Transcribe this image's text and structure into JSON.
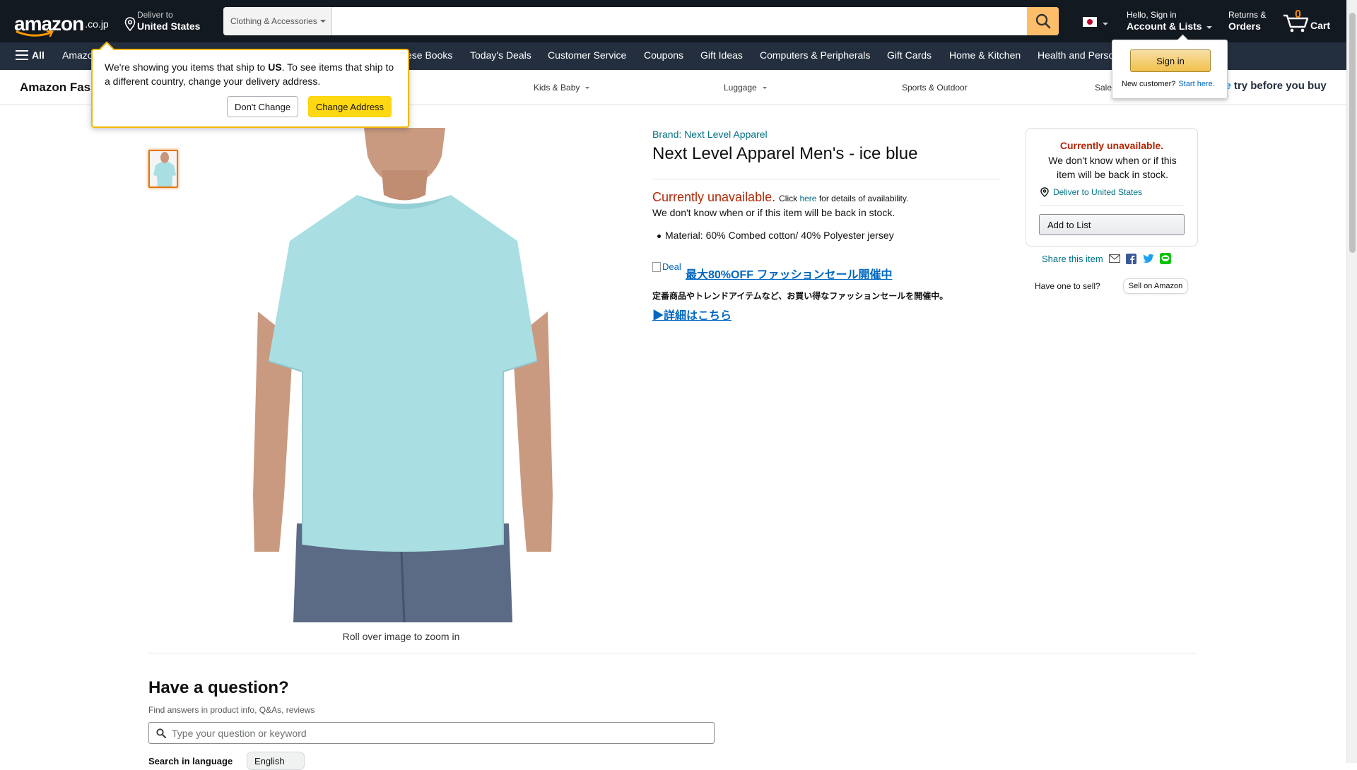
{
  "header": {
    "logo_text": "amazon",
    "logo_tld": ".co.jp",
    "deliver_line1": "Deliver to",
    "deliver_line2": "United States",
    "search_category": "Clothing & Accessories",
    "search_placeholder": "",
    "language_flag": "JP",
    "account_line1": "Hello, Sign in",
    "account_line2": "Account & Lists",
    "orders_line1": "Returns &",
    "orders_line2": "Orders",
    "cart_count": "0",
    "cart_label": "Cart"
  },
  "subnav": {
    "all_label": "All",
    "items": [
      "Amazon",
      "ese Books",
      "Today's Deals",
      "Customer Service",
      "Coupons",
      "Gift Ideas",
      "Computers & Peripherals",
      "Gift Cards",
      "Home & Kitchen",
      "Health and Perso"
    ]
  },
  "category_bar": {
    "title": "Amazon Fas",
    "links": [
      "Kids & Baby",
      "Luggage",
      "Sports & Outdoor",
      "Sale"
    ],
    "promo_prefix": "me",
    "promo_text": "try before you buy"
  },
  "address_popover": {
    "message_pre": "We're showing you items that ship to ",
    "message_country": "US",
    "message_post": ". To see items that ship to a different country, change your delivery address.",
    "dont_change": "Don't Change",
    "change_address": "Change Address"
  },
  "signin_popover": {
    "button": "Sign in",
    "new_customer": "New customer?",
    "start_here": "Start here."
  },
  "product": {
    "brand": "Brand: Next Level Apparel",
    "title": "Next Level Apparel Men's - ice blue",
    "unavailable": "Currently unavailable.",
    "click": "Click",
    "here": "here",
    "details": "for details of availability.",
    "unknown_stock": "We don't know when or if this item will be back in stock.",
    "material": "Material: 60% Combed cotton/ 40% Polyester jersey",
    "deal_alt": "Deal",
    "deal_headline": "最大80%OFF ファッションセール開催中",
    "deal_sub": "定番商品やトレンドアイテムなど、お買い得なファッションセールを開催中。",
    "deal_more": "▶詳細はこちら",
    "rollover": "Roll over image to zoom in",
    "shirt_color": "#a9dfe3"
  },
  "buybox": {
    "unavailable": "Currently unavailable.",
    "unknown_stock": "We don't know when or if this item will be back in stock.",
    "deliver": "Deliver to United States",
    "add_to_list": "Add to List",
    "share": "Share this item",
    "sell_question": "Have one to sell?",
    "sell_button": "Sell on Amazon"
  },
  "questions": {
    "heading": "Have a question?",
    "subtext": "Find answers in product info, Q&As, reviews",
    "placeholder": "Type your question or keyword",
    "language_label": "Search in language",
    "language_value": "English"
  },
  "colors": {
    "nav_dark": "#131921",
    "nav_secondary": "#232f3e",
    "search_button": "#febd69",
    "accent_yellow": "#ffd814",
    "link_teal": "#007185",
    "unavailable_red": "#b12704"
  }
}
